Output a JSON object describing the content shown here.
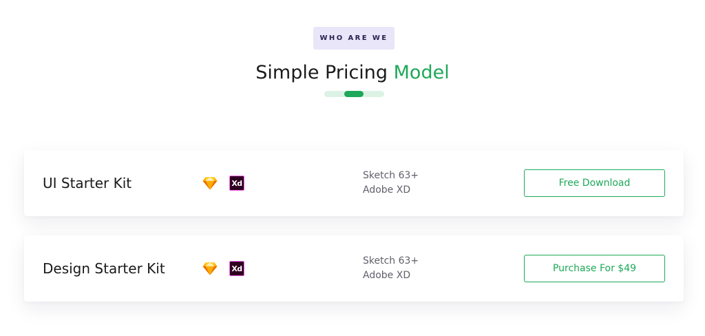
{
  "section": {
    "badge": "WHO ARE WE",
    "title_main": "Simple Pricing ",
    "title_accent": "Model"
  },
  "colors": {
    "accent": "#1ea859",
    "badge_bg": "#e8e6f8",
    "xd_bg": "#2e001f",
    "xd_border": "#ff61f6"
  },
  "cards": [
    {
      "name": "UI Starter Kit",
      "icons": [
        "sketch-icon",
        "adobe-xd-icon"
      ],
      "xd_label": "Xd",
      "specs": [
        "Sketch 63+",
        "Adobe XD"
      ],
      "button": "Free Download"
    },
    {
      "name": "Design Starter Kit",
      "icons": [
        "sketch-icon",
        "adobe-xd-icon"
      ],
      "xd_label": "Xd",
      "specs": [
        "Sketch 63+",
        "Adobe XD"
      ],
      "button": "Purchase For $49"
    }
  ]
}
